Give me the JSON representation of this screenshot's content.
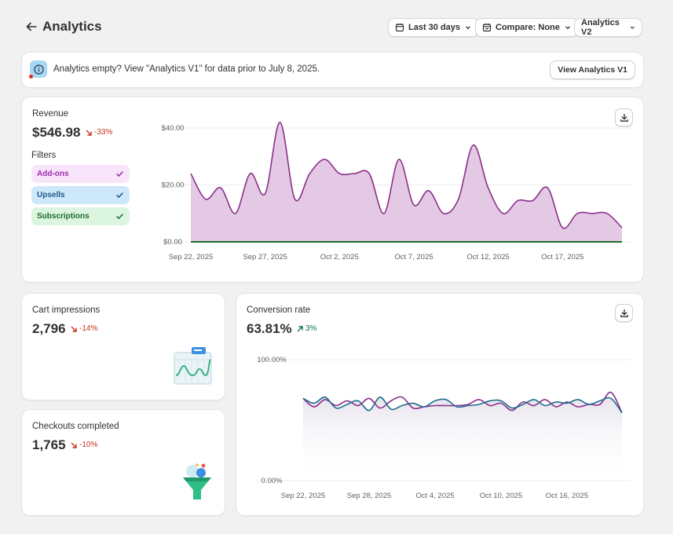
{
  "header": {
    "title": "Analytics",
    "date_range": "Last 30 days",
    "compare": "Compare: None",
    "version": "Analytics V2"
  },
  "banner": {
    "text": "Analytics empty? View \"Analytics V1\" for data prior to July 8, 2025.",
    "button": "View Analytics V1"
  },
  "revenue": {
    "title": "Revenue",
    "value": "$546.98",
    "delta": "-33%",
    "filters_label": "Filters",
    "filters": [
      {
        "label": "Add-ons",
        "bg": "#f9e5fb",
        "color": "#9b2ca8"
      },
      {
        "label": "Upsells",
        "bg": "#cde7fb",
        "color": "#1e5a8a"
      },
      {
        "label": "Subscriptions",
        "bg": "#dcf5e0",
        "color": "#1d6b2d"
      }
    ]
  },
  "cart": {
    "title": "Cart impressions",
    "value": "2,796",
    "delta": "-14%"
  },
  "checkouts": {
    "title": "Checkouts completed",
    "value": "1,765",
    "delta": "-10%"
  },
  "conversion": {
    "title": "Conversion rate",
    "value": "63.81%",
    "delta": "3%"
  },
  "colors": {
    "accent_purple": "#8c2f8c",
    "area_fill": "#e3c9e3",
    "baseline_green": "#1a6b2f",
    "series_blue": "#1f6c8f",
    "down": "#c7311c",
    "up": "#0c7a3e"
  },
  "chart_data": [
    {
      "type": "area",
      "yticks": [
        "$40.00",
        "$20.00",
        "$0.00"
      ],
      "ylim": [
        0,
        45
      ],
      "xticks": [
        "Sep 22, 2025",
        "Sep 27, 2025",
        "Oct 2, 2025",
        "Oct 7, 2025",
        "Oct 12, 2025",
        "Oct 17, 2025"
      ],
      "x": [
        "Sep 22",
        "Sep 23",
        "Sep 24",
        "Sep 25",
        "Sep 26",
        "Sep 27",
        "Sep 28",
        "Sep 29",
        "Sep 30",
        "Oct 1",
        "Oct 2",
        "Oct 3",
        "Oct 4",
        "Oct 5",
        "Oct 6",
        "Oct 7",
        "Oct 8",
        "Oct 9",
        "Oct 10",
        "Oct 11",
        "Oct 12",
        "Oct 13",
        "Oct 14",
        "Oct 15",
        "Oct 16",
        "Oct 17",
        "Oct 18",
        "Oct 19",
        "Oct 20",
        "Oct 21"
      ],
      "series": [
        {
          "values": [
            24,
            15,
            19,
            10,
            24,
            17,
            42,
            15,
            24,
            29,
            24,
            24,
            24,
            10,
            29,
            13,
            18,
            10,
            15,
            34,
            19,
            10,
            14.5,
            14.5,
            19,
            5,
            10,
            10,
            10,
            5
          ]
        },
        {
          "values": [
            0,
            0,
            0,
            0,
            0,
            0,
            0,
            0,
            0,
            0,
            0,
            0,
            0,
            0,
            0,
            0,
            0,
            0,
            0,
            0,
            0,
            0,
            0,
            0,
            0,
            0,
            0,
            0,
            0,
            0
          ]
        }
      ]
    },
    {
      "type": "line",
      "yticks": [
        "100.00%",
        "0.00%"
      ],
      "ylim": [
        0,
        100
      ],
      "xticks": [
        "Sep 22, 2025",
        "Sep 28, 2025",
        "Oct 4, 2025",
        "Oct 10, 2025",
        "Oct 16, 2025"
      ],
      "series": [
        {
          "values": [
            68,
            64,
            69,
            60,
            63,
            66,
            58,
            69,
            59,
            62,
            64,
            61,
            66,
            67,
            61,
            62,
            63,
            66,
            66,
            60,
            63,
            67,
            62,
            65,
            64,
            67,
            63,
            66,
            68,
            56
          ]
        },
        {
          "values": [
            68,
            61,
            67,
            62,
            66,
            62,
            68,
            60,
            66,
            69,
            60,
            61,
            62,
            62,
            62,
            63,
            67,
            62,
            64,
            58,
            65,
            62,
            67,
            61,
            65,
            61,
            63,
            63,
            73,
            56
          ]
        }
      ]
    }
  ]
}
